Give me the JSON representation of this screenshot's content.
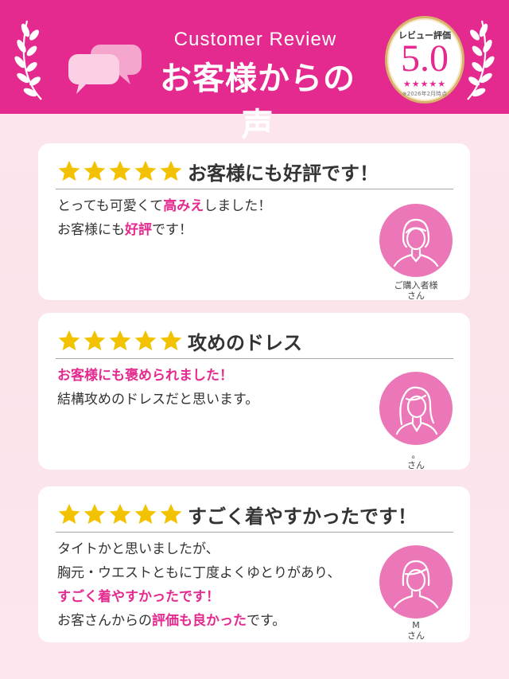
{
  "header": {
    "title_en": "Customer Review",
    "title_jp": "お客様からの声",
    "badge": {
      "label": "レビュー評価",
      "score": "5.0",
      "stars": "★★★★★",
      "note": "※2026年2月時点"
    }
  },
  "colors": {
    "brand_pink": "#e52a8f",
    "star_yellow": "#f2c200",
    "gold": "#d8b36c"
  },
  "reviews": [
    {
      "rating": 5,
      "title": "お客様にも好評です！",
      "lines": [
        [
          {
            "text": "とっても可愛くて"
          },
          {
            "text": "高みえ",
            "highlight": true
          },
          {
            "text": "しました！"
          }
        ],
        [
          {
            "text": "お客様にも"
          },
          {
            "text": "好評",
            "highlight": true
          },
          {
            "text": "です！"
          }
        ]
      ],
      "reviewer": {
        "name": "ご購入者様",
        "suffix": "さん",
        "avatar_icon": "woman-avatar-icon"
      }
    },
    {
      "rating": 5,
      "title": "攻めのドレス",
      "lines": [
        [
          {
            "text": "お客様にも褒められました！",
            "highlight": true
          }
        ],
        [
          {
            "text": "結構攻めのドレスだと思います。"
          }
        ]
      ],
      "reviewer": {
        "name": "。",
        "suffix": "さん",
        "avatar_icon": "woman-long-hair-avatar-icon"
      }
    },
    {
      "rating": 5,
      "title": "すごく着やすかったです！",
      "lines": [
        [
          {
            "text": "タイトかと思いましたが、"
          }
        ],
        [
          {
            "text": "胸元・ウエストともに丁度よくゆとりがあり、"
          }
        ],
        [
          {
            "text": "すごく着やすかったです！",
            "highlight": true
          }
        ],
        [
          {
            "text": "お客さんからの"
          },
          {
            "text": "評価も良かった",
            "highlight": true
          },
          {
            "text": "です。"
          }
        ]
      ],
      "reviewer": {
        "name": "M",
        "suffix": "さん",
        "avatar_icon": "woman-avatar-icon"
      }
    }
  ]
}
